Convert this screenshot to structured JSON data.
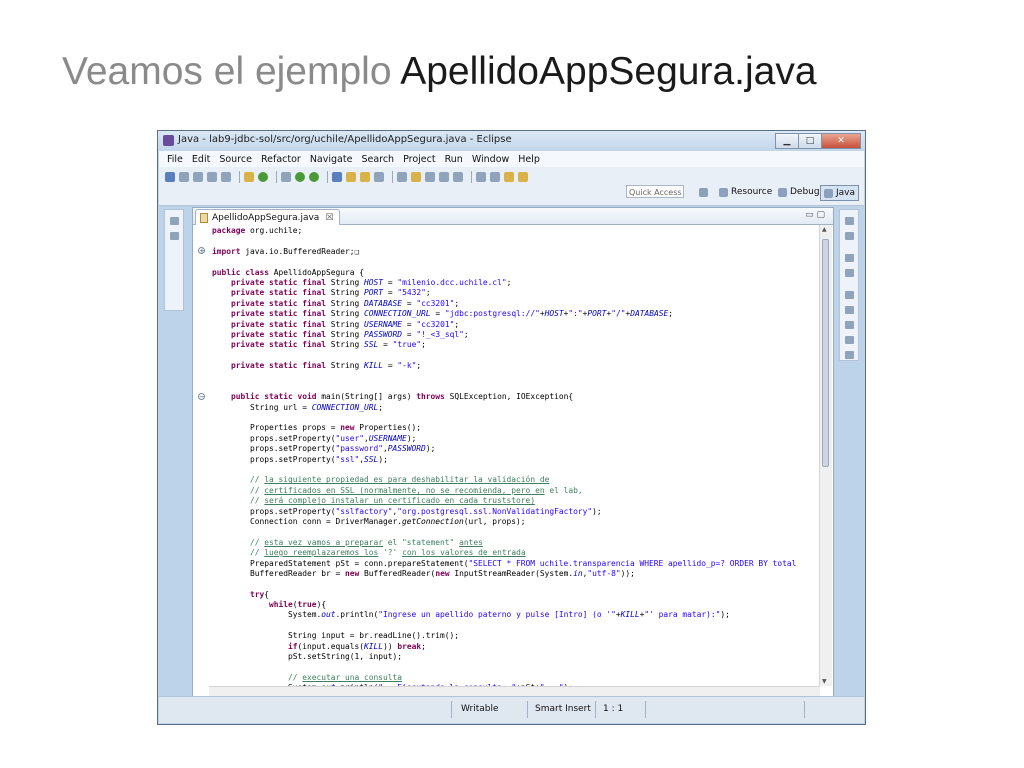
{
  "slide": {
    "title_part1": "Veamos el ejemplo",
    "title_part2": "ApellidoAppSegura.java"
  },
  "window": {
    "title": "Java - lab9-jdbc-sol/src/org/uchile/ApellidoAppSegura.java - Eclipse",
    "minimize": "▁",
    "maximize": "□",
    "close": "✕"
  },
  "menu": [
    "File",
    "Edit",
    "Source",
    "Refactor",
    "Navigate",
    "Search",
    "Project",
    "Run",
    "Window",
    "Help"
  ],
  "toolbar": {
    "quick_access_placeholder": "Quick Access",
    "perspectives": [
      "Resource",
      "Debug",
      "Java"
    ],
    "active_perspective": "Java"
  },
  "editor": {
    "tab_label": "ApellidoAppSegura.java",
    "tab_close": "☒",
    "min_max": "▭ ▢",
    "fold_collapsed": "+",
    "fold_expanded": "−"
  },
  "code_lines": [
    "package org.uchile;",
    "",
    "import java.io.BufferedReader;❑",
    "",
    "public class ApellidoAppSegura {",
    "    private static final String HOST = \"milenio.dcc.uchile.cl\";",
    "    private static final String PORT = \"5432\";",
    "    private static final String DATABASE = \"cc3201\";",
    "    private static final String CONNECTION_URL = \"jdbc:postgresql://\"+HOST+\":\"+PORT+\"/\"+DATABASE;",
    "    private static final String USERNAME = \"cc3201\";",
    "    private static final String PASSWORD = \"!_<3_sql\";",
    "    private static final String SSL = \"true\";",
    "",
    "    private static final String KILL = \"-k\";",
    "",
    "",
    "    public static void main(String[] args) throws SQLException, IOException{",
    "        String url = CONNECTION_URL;",
    "",
    "        Properties props = new Properties();",
    "        props.setProperty(\"user\",USERNAME);",
    "        props.setProperty(\"password\",PASSWORD);",
    "        props.setProperty(\"ssl\",SSL);",
    "",
    "        // la siguiente propiedad es para deshabilitar la validación de",
    "        // certificados en SSL (normalmente, no se recomienda, pero en el lab,",
    "        // será complejo instalar un certificado en cada truststore)",
    "        props.setProperty(\"sslfactory\",\"org.postgresql.ssl.NonValidatingFactory\");",
    "        Connection conn = DriverManager.getConnection(url, props);",
    "",
    "        // esta vez vamos a preparar el \"statement\" antes",
    "        // luego reemplazaremos los '?' con los valores de entrada",
    "        PreparedStatement pSt = conn.prepareStatement(\"SELECT * FROM uchile.transparencia WHERE apellido_p=? ORDER BY total",
    "        BufferedReader br = new BufferedReader(new InputStreamReader(System.in,\"utf-8\"));",
    "",
    "        try{",
    "            while(true){",
    "                System.out.println(\"Ingrese un apellido paterno y pulse [Intro] (o '\"+KILL+\"' para matar):\");",
    "",
    "                String input = br.readLine().trim();",
    "                if(input.equals(KILL)) break;",
    "                pSt.setString(1, input);",
    "",
    "                // executar una consulta",
    "                System.out.println(\"===Ejecutando la consulta: \"+pSt+\"===\");"
  ],
  "status": {
    "writable": "Writable",
    "insert_mode": "Smart Insert",
    "position": "1 : 1"
  }
}
